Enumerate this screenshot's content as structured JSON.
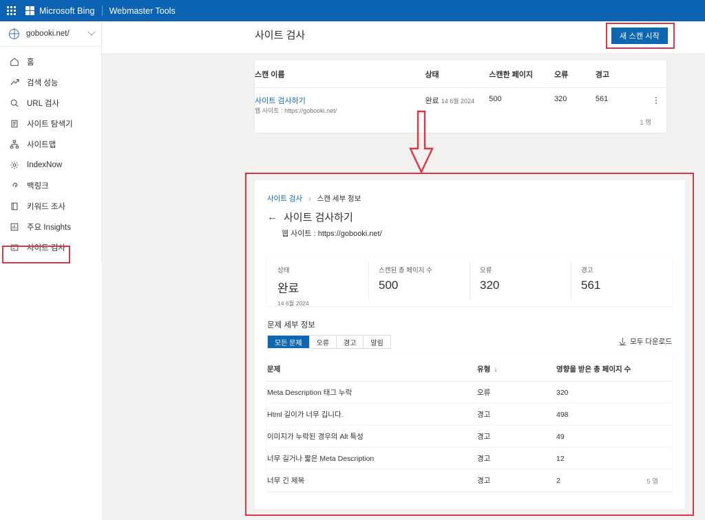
{
  "topbar": {
    "waffle_icon": "app-launcher-icon",
    "logo_icon": "microsoft-logo-icon",
    "brand": "Microsoft Bing",
    "product": "Webmaster Tools"
  },
  "sidebar": {
    "site": {
      "icon": "globe-icon",
      "name": "gobooki.net/",
      "chevron_icon": "chevron-down-icon"
    },
    "items": [
      {
        "label": "홈",
        "icon": "home-icon",
        "key": "home"
      },
      {
        "label": "검색 성능",
        "icon": "trending-up-icon",
        "key": "search-performance"
      },
      {
        "label": "URL 검사",
        "icon": "search-icon",
        "key": "url-inspection"
      },
      {
        "label": "사이트 탐색기",
        "icon": "clipboard-icon",
        "key": "site-explorer"
      },
      {
        "label": "사이트맵",
        "icon": "sitemap-icon",
        "key": "sitemaps"
      },
      {
        "label": "IndexNow",
        "icon": "gear-icon",
        "key": "indexnow"
      },
      {
        "label": "백링크",
        "icon": "link-icon",
        "key": "backlinks"
      },
      {
        "label": "키워드 조사",
        "icon": "book-icon",
        "key": "keyword-research"
      },
      {
        "label": "주요 Insights",
        "icon": "insights-icon",
        "key": "top-insights"
      },
      {
        "label": "사이트 검사",
        "icon": "site-scan-icon",
        "key": "site-scan"
      }
    ],
    "highlighted_item": "사이트 검사"
  },
  "header": {
    "title": "사이트 검사",
    "new_scan_button": "새 스캔 시작"
  },
  "scan_table": {
    "columns": [
      "스캔 이름",
      "상태",
      "스캔한 페이지",
      "오류",
      "경고"
    ],
    "rows": [
      {
        "name": "사이트 검사하기",
        "subtitle": "웹 사이트 : https://gobooki.net/",
        "status": "완료",
        "date": "14 6월 2024",
        "pages": "500",
        "errors": "320",
        "warnings": "561",
        "menu_icon": "more-vertical-icon"
      }
    ],
    "row_count": "1 행"
  },
  "annotations": {
    "arrow_icon": "down-arrow-annotation",
    "arrow_color": "#dc3545",
    "box_color": "#dc3545"
  },
  "detail": {
    "breadcrumb": {
      "parent": "사이트 검사",
      "separator": "›",
      "current": "스캔 세부 정보"
    },
    "back_icon": "back-arrow-icon",
    "title": "사이트 검사하기",
    "subtitle": "웹 사이트 : https://gobooki.net/",
    "stats": [
      {
        "label": "상태",
        "value": "완료",
        "date": "14 6월 2024"
      },
      {
        "label": "스캔된 총 페이지 수",
        "value": "500",
        "date": ""
      },
      {
        "label": "오류",
        "value": "320",
        "date": ""
      },
      {
        "label": "경고",
        "value": "561",
        "date": ""
      }
    ],
    "issues": {
      "section_title": "문제 세부 정보",
      "tabs": [
        {
          "label": "모든 문제",
          "active": true
        },
        {
          "label": "오류",
          "active": false
        },
        {
          "label": "경고",
          "active": false
        },
        {
          "label": "알림",
          "active": false
        }
      ],
      "download_label": "모두 다운로드",
      "download_icon": "download-icon",
      "columns": [
        "문제",
        "유형",
        "영향을 받은 총 페이지 수"
      ],
      "sort_icon": "↓",
      "rows": [
        {
          "issue": "Meta Description 태그 누락",
          "type": "오류",
          "type_kind": "error",
          "count": "320"
        },
        {
          "issue": "Html 길이가 너무 깁니다.",
          "type": "경고",
          "type_kind": "warning",
          "count": "498"
        },
        {
          "issue": "이미지가 누락된 경우의 Alt 특성",
          "type": "경고",
          "type_kind": "warning",
          "count": "49"
        },
        {
          "issue": "너무 길거나 짧은 Meta Description",
          "type": "경고",
          "type_kind": "warning",
          "count": "12"
        },
        {
          "issue": "너무 긴 제목",
          "type": "경고",
          "type_kind": "warning",
          "count": "2"
        }
      ],
      "row_count": "5 열"
    }
  }
}
